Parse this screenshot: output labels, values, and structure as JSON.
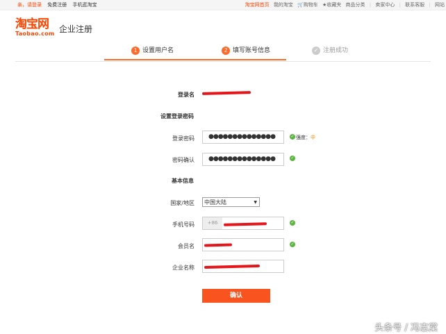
{
  "topbar": {
    "greeting": "亲，请登录",
    "register": "免费注册",
    "mobile": "手机逛淘宝",
    "links": [
      "淘宝网首页",
      "我的淘宝",
      "购物车",
      "收藏夹",
      "商品分类",
      "卖家中心",
      "联系客服",
      "网站"
    ]
  },
  "logo": {
    "cn": "淘宝网",
    "en": "Taobao.com",
    "title": "企业注册"
  },
  "steps": [
    {
      "num": "1",
      "label": "设置用户名"
    },
    {
      "num": "2",
      "label": "填写账号信息"
    },
    {
      "num": "✓",
      "label": "注册成功"
    }
  ],
  "form": {
    "login_name_label": "登录名",
    "password_section": "设置登录密码",
    "password_label": "登录密码",
    "password_value": "●●●●●●●●●●●●●●",
    "strength_label": "强度：",
    "strength_value": "中",
    "confirm_label": "密码确认",
    "confirm_value": "●●●●●●●●●●●●●●",
    "basic_section": "基本信息",
    "country_label": "国家/地区",
    "country_value": "中国大陆",
    "phone_label": "手机号码",
    "phone_prefix": "+86",
    "member_label": "会员名",
    "company_label": "企业名称",
    "submit_label": "确认"
  },
  "watermark": "头条号 / 冯志棠",
  "colors": {
    "brand": "#ff4400",
    "step_active": "#ff6a2a",
    "success": "#5cb53f",
    "redact": "#e3161b"
  }
}
